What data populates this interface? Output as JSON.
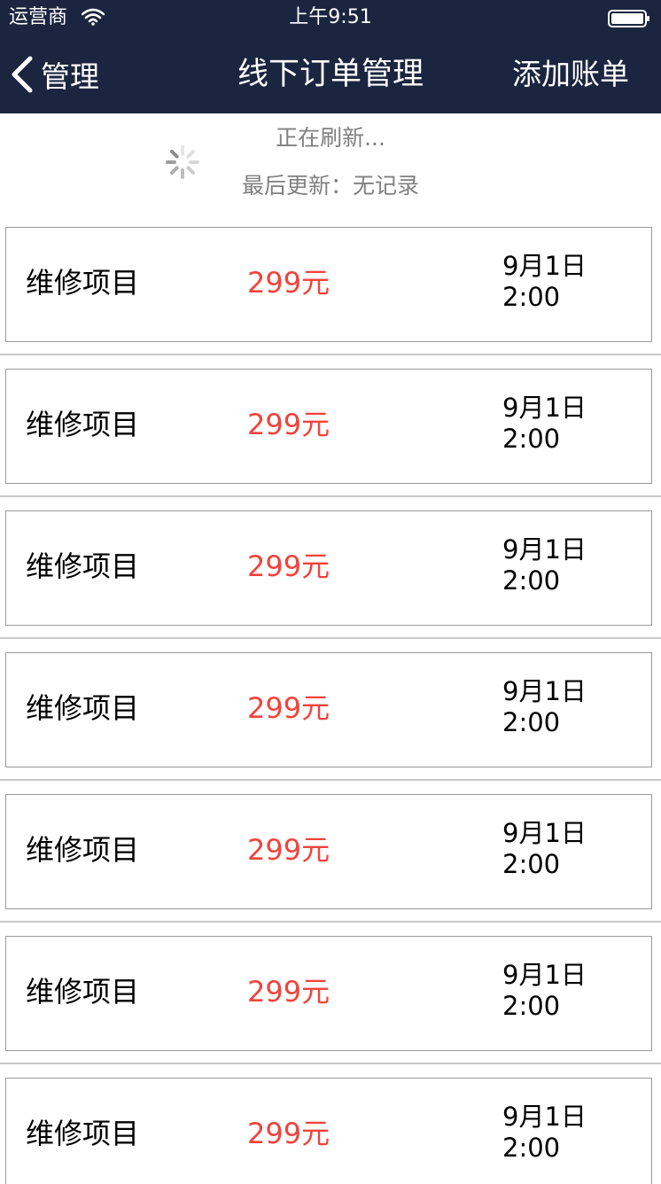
{
  "status_bar": {
    "carrier": "运营商",
    "time": "上午9:51"
  },
  "nav": {
    "back_label": "管理",
    "title": "线下订单管理",
    "action_label": "添加账单"
  },
  "refresh": {
    "status": "正在刷新...",
    "last_updated": "最后更新：无记录"
  },
  "orders": [
    {
      "name": "维修项目",
      "price": "299元",
      "date": "9月1日",
      "time": "2:00"
    },
    {
      "name": "维修项目",
      "price": "299元",
      "date": "9月1日",
      "time": "2:00"
    },
    {
      "name": "维修项目",
      "price": "299元",
      "date": "9月1日",
      "time": "2:00"
    },
    {
      "name": "维修项目",
      "price": "299元",
      "date": "9月1日",
      "time": "2:00"
    },
    {
      "name": "维修项目",
      "price": "299元",
      "date": "9月1日",
      "time": "2:00"
    },
    {
      "name": "维修项目",
      "price": "299元",
      "date": "9月1日",
      "time": "2:00"
    },
    {
      "name": "维修项目",
      "price": "299元",
      "date": "9月1日",
      "time": "2:00"
    }
  ],
  "colors": {
    "nav_background": "#1b2540",
    "price": "#f2433b",
    "secondary_text": "#808080"
  },
  "icons": {
    "back": "chevron-left-icon",
    "wifi": "wifi-icon",
    "battery": "battery-icon",
    "spinner": "loading-spinner-icon"
  }
}
